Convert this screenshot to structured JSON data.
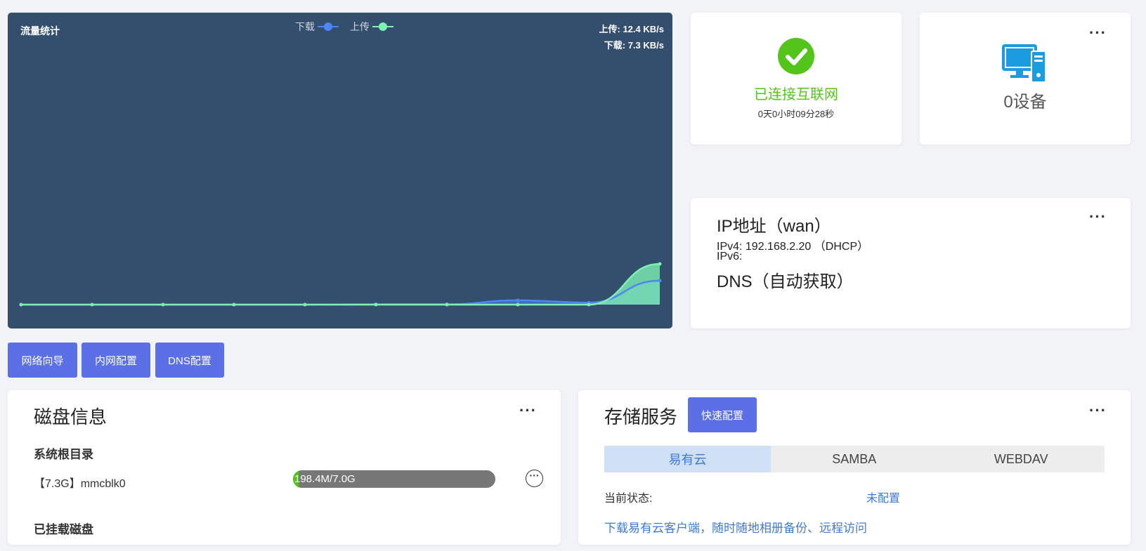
{
  "traffic": {
    "title": "流量统计",
    "legend": [
      {
        "label": "下载",
        "color": "#4d86f5"
      },
      {
        "label": "上传",
        "color": "#7ef0b2"
      }
    ],
    "upload_rate": "上传: 12.4 KB/s",
    "download_rate": "下载: 7.3 KB/s",
    "chart_data": {
      "type": "area",
      "title": "流量统计",
      "series": [
        {
          "name": "下载",
          "values": [
            0,
            0,
            0,
            0,
            0,
            0.1,
            0.1,
            1.3,
            0.6,
            7.3
          ]
        },
        {
          "name": "上传",
          "values": [
            0,
            0,
            0,
            0,
            0,
            0,
            0,
            0,
            0,
            12.4
          ]
        }
      ],
      "ylim": [
        0,
        80
      ],
      "grid": false,
      "legend": "top-center"
    }
  },
  "internet": {
    "status": "已连接互联网",
    "uptime": "0天0小时09分28秒",
    "status_color": "#52c41a"
  },
  "devices": {
    "count_label": "0设备",
    "icon": "monitor-icon",
    "icon_color": "#1b9be0"
  },
  "ip": {
    "title": "IP地址（wan）",
    "ipv4": "IPv4:   192.168.2.20 （DHCP）",
    "ipv6": "IPv6:",
    "dns": "DNS（自动获取）"
  },
  "nav_buttons": {
    "wizard": "网络向导",
    "lan": "内网配置",
    "dns": "DNS配置"
  },
  "disk": {
    "title": "磁盘信息",
    "root_heading": "系统根目录",
    "root_device": "【7.3G】mmcblk0",
    "usage_label": "198.4M/7.0G",
    "usage_fraction": 0.028,
    "mounted_heading": "已挂载磁盘"
  },
  "storage": {
    "title": "存储服务",
    "quick_config": "快速配置",
    "tabs": [
      "易有云",
      "SAMBA",
      "WEBDAV"
    ],
    "state_label": "当前状态:",
    "state_value": "未配置",
    "download_text": "下载易有云客户端，随时随地相册备份、远程访问"
  },
  "more_glyph": "···"
}
